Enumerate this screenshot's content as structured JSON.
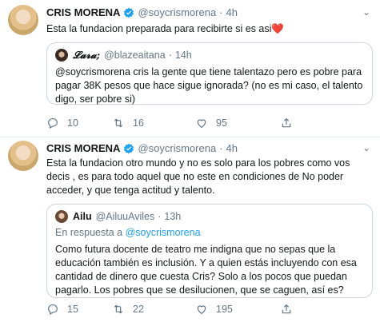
{
  "tweets": [
    {
      "author_name": "CRIS MORENA",
      "author_handle": "@soycrismorena",
      "time": "4h",
      "text": "Esta la fundacion preparada para recibirte si es asi",
      "heart_emoji": "❤️",
      "quote": {
        "author_name": "𝓛𝓪𝓻𝓪;",
        "author_handle": "@blazeaitana",
        "time": "14h",
        "text": "@soycrismorena cris la gente que tiene talentazo pero es pobre para pagar 38K pesos que hace sigue ignorada? (no es mi caso, el talento digo, ser pobre si)"
      },
      "actions": {
        "replies": "10",
        "retweets": "16",
        "likes": "95"
      }
    },
    {
      "author_name": "CRIS MORENA",
      "author_handle": "@soycrismorena",
      "time": "4h",
      "text": "Esta la fundacion otro mundo y no es solo para los pobres como vos decis , es para todo aquel que no este en condiciones de No poder acceder,  y que tenga actitud y talento.",
      "quote": {
        "author_name": "Ailu",
        "author_handle": "@AiluuAviles",
        "time": "13h",
        "reply_prefix": "En respuesta a",
        "reply_to": "@soycrismorena",
        "text": "Como futura docente de teatro me indigna que no sepas que la educación también es inclusión. Y a quien estás incluyendo con esa cantidad de dinero que cuesta Cris? Solo a los pocos que puedan pagarlo. Los pobres que se desilucionen, que se caguen, así es?"
      },
      "actions": {
        "replies": "15",
        "retweets": "22",
        "likes": "195"
      }
    }
  ],
  "colors": {
    "accent": "#1da1f2",
    "heart": "#e0245e",
    "muted": "#657786",
    "border": "#e6ecf0"
  },
  "icons": [
    "verified-badge-icon",
    "chevron-down-icon",
    "reply-icon",
    "retweet-icon",
    "like-icon",
    "share-icon"
  ]
}
